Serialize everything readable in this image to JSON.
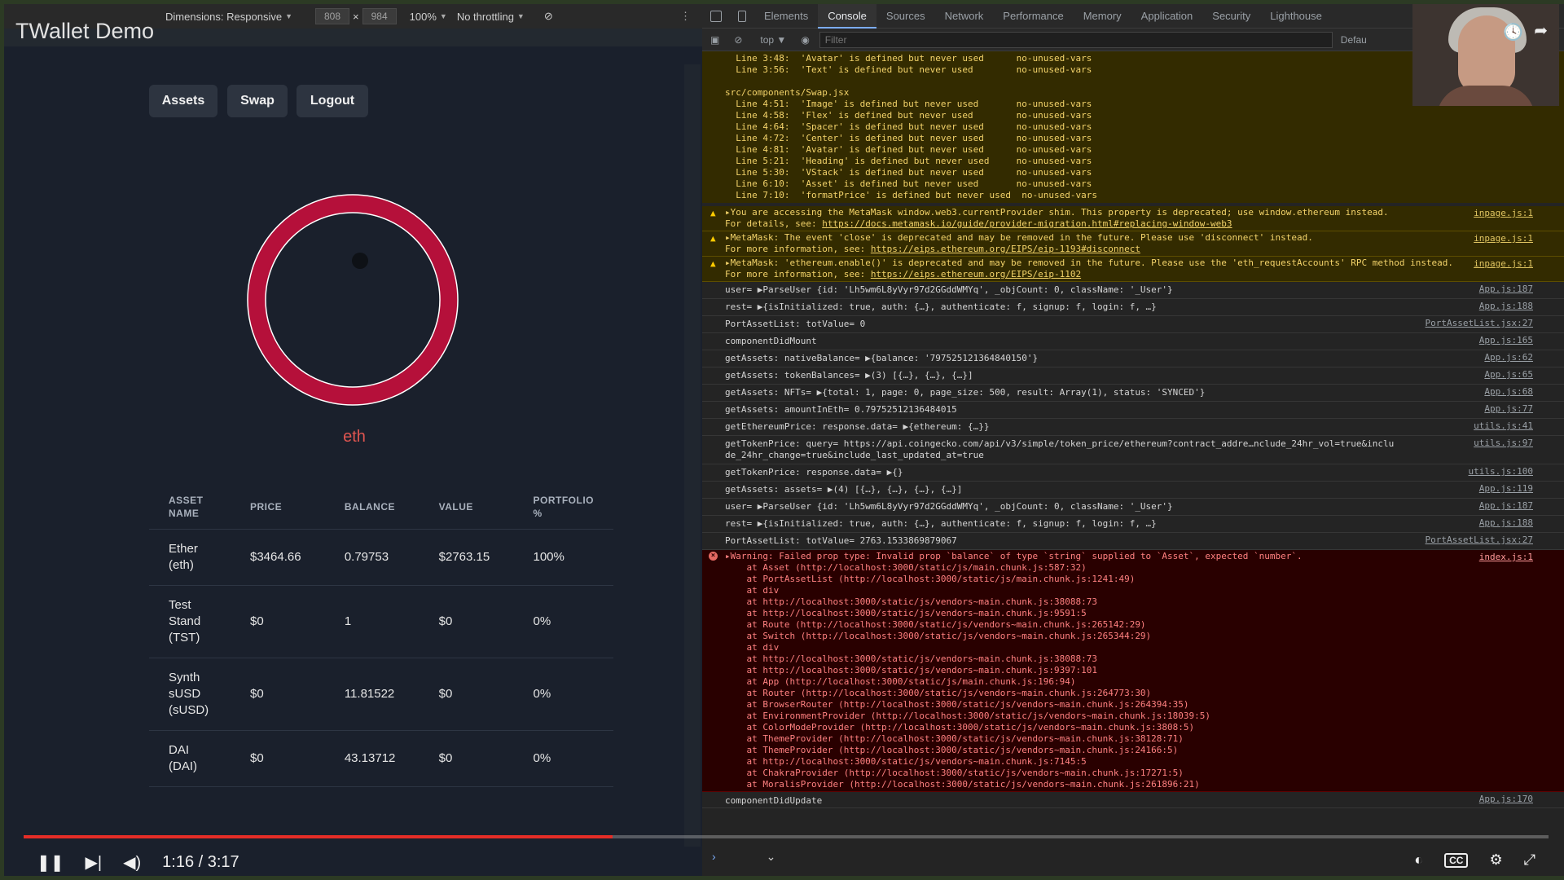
{
  "device_toolbar": {
    "dimensions_label": "Dimensions: Responsive",
    "width": "808",
    "height": "984",
    "zoom": "100%",
    "throttling": "No throttling"
  },
  "app": {
    "title": "TWallet Demo",
    "nav": [
      "Assets",
      "Swap",
      "Logout"
    ],
    "token_label": "eth",
    "donut_color": "#b5103a",
    "table": {
      "headers": [
        "ASSET NAME",
        "PRICE",
        "BALANCE",
        "VALUE",
        "PORTFOLIO %"
      ],
      "rows": [
        [
          "Ether (eth)",
          "$3464.66",
          "0.79753",
          "$2763.15",
          "100%"
        ],
        [
          "Test Stand (TST)",
          "$0",
          "1",
          "$0",
          "0%"
        ],
        [
          "Synth sUSD (sUSD)",
          "$0",
          "11.81522",
          "$0",
          "0%"
        ],
        [
          "DAI (DAI)",
          "$0",
          "43.13712",
          "$0",
          "0%"
        ]
      ]
    }
  },
  "video": {
    "time": "1:16 / 3:17",
    "progress": 0.386
  },
  "devtools": {
    "tabs": [
      "Elements",
      "Console",
      "Sources",
      "Network",
      "Performance",
      "Memory",
      "Application",
      "Security",
      "Lighthouse"
    ],
    "active_tab": "Console",
    "context": "top",
    "filter_placeholder": "Filter",
    "levels": "Defau",
    "lint_lines": [
      "  Line 3:48:  'Avatar' is defined but never used      no-unused-vars",
      "  Line 3:56:  'Text' is defined but never used        no-unused-vars",
      "",
      "src/components/Swap.jsx",
      "  Line 4:51:  'Image' is defined but never used       no-unused-vars",
      "  Line 4:58:  'Flex' is defined but never used        no-unused-vars",
      "  Line 4:64:  'Spacer' is defined but never used      no-unused-vars",
      "  Line 4:72:  'Center' is defined but never used      no-unused-vars",
      "  Line 4:81:  'Avatar' is defined but never used      no-unused-vars",
      "  Line 5:21:  'Heading' is defined but never used     no-unused-vars",
      "  Line 5:30:  'VStack' is defined but never used      no-unused-vars",
      "  Line 6:10:  'Asset' is defined but never used       no-unused-vars",
      "  Line 7:10:  'formatPrice' is defined but never used  no-unused-vars"
    ],
    "warnings": [
      {
        "text": "You are accessing the MetaMask window.web3.currentProvider shim. This property is deprecated; use window.ethereum instead.",
        "more": "For details, see: ",
        "link": "https://docs.metamask.io/guide/provider-migration.html#replacing-window-web3",
        "src": "inpage.js:1"
      },
      {
        "text": "MetaMask: The event 'close' is deprecated and may be removed in the future. Please use 'disconnect' instead.",
        "more": "For more information, see: ",
        "link": "https://eips.ethereum.org/EIPS/eip-1193#disconnect",
        "src": "inpage.js:1"
      },
      {
        "text": "MetaMask: 'ethereum.enable()' is deprecated and may be removed in the future. Please use the 'eth_requestAccounts' RPC method instead.",
        "more": "For more information, see: ",
        "link": "https://eips.ethereum.org/EIPS/eip-1102",
        "src": "inpage.js:1"
      }
    ],
    "logs": [
      {
        "text": "user= ▶ParseUser {id: 'Lh5wm6L8yVyr97d2GGddWMYq', _objCount: 0, className: '_User'}",
        "src": "App.js:187"
      },
      {
        "text": "rest= ▶{isInitialized: true, auth: {…}, authenticate: f, signup: f, login: f, …}",
        "src": "App.js:188"
      },
      {
        "text": "PortAssetList: totValue= 0",
        "src": "PortAssetList.jsx:27"
      },
      {
        "text": "componentDidMount",
        "src": "App.js:165"
      },
      {
        "text": "getAssets: nativeBalance= ▶{balance: '797525121364840150'}",
        "src": "App.js:62"
      },
      {
        "text": "getAssets: tokenBalances= ▶(3) [{…}, {…}, {…}]",
        "src": "App.js:65"
      },
      {
        "text": "getAssets: NFTs= ▶{total: 1, page: 0, page_size: 500, result: Array(1), status: 'SYNCED'}",
        "src": "App.js:68"
      },
      {
        "text": "getAssets: amountInEth= 0.79752512136484015",
        "src": "App.js:77"
      },
      {
        "text": "getEthereumPrice: response.data= ▶{ethereum: {…}}",
        "src": "utils.js:41"
      },
      {
        "text": "getTokenPrice: query= https://api.coingecko.com/api/v3/simple/token_price/ethereum?contract_addre…nclude_24hr_vol=true&inclu de_24hr_change=true&include_last_updated_at=true",
        "src": "utils.js:97"
      },
      {
        "text": "getTokenPrice: response.data= ▶{}",
        "src": "utils.js:100"
      },
      {
        "text": "getAssets: assets= ▶(4) [{…}, {…}, {…}, {…}]",
        "src": "App.js:119"
      },
      {
        "text": "user= ▶ParseUser {id: 'Lh5wm6L8yVyr97d2GGddWMYq', _objCount: 0, className: '_User'}",
        "src": "App.js:187"
      },
      {
        "text": "rest= ▶{isInitialized: true, auth: {…}, authenticate: f, signup: f, login: f, …}",
        "src": "App.js:188"
      },
      {
        "text": "PortAssetList: totValue= 2763.1533869879067",
        "src": "PortAssetList.jsx:27"
      }
    ],
    "error": {
      "text": "Warning: Failed prop type: Invalid prop `balance` of type `string` supplied to `Asset`, expected `number`.",
      "src": "index.js:1",
      "stack": [
        "at Asset (http://localhost:3000/static/js/main.chunk.js:587:32)",
        "at PortAssetList (http://localhost:3000/static/js/main.chunk.js:1241:49)",
        "at div",
        "at http://localhost:3000/static/js/vendors~main.chunk.js:38088:73",
        "at http://localhost:3000/static/js/vendors~main.chunk.js:9591:5",
        "at Route (http://localhost:3000/static/js/vendors~main.chunk.js:265142:29)",
        "at Switch (http://localhost:3000/static/js/vendors~main.chunk.js:265344:29)",
        "at div",
        "at http://localhost:3000/static/js/vendors~main.chunk.js:38088:73",
        "at http://localhost:3000/static/js/vendors~main.chunk.js:9397:101",
        "at App (http://localhost:3000/static/js/main.chunk.js:196:94)",
        "at Router (http://localhost:3000/static/js/vendors~main.chunk.js:264773:30)",
        "at BrowserRouter (http://localhost:3000/static/js/vendors~main.chunk.js:264394:35)",
        "at EnvironmentProvider (http://localhost:3000/static/js/vendors~main.chunk.js:18039:5)",
        "at ColorModeProvider (http://localhost:3000/static/js/vendors~main.chunk.js:3808:5)",
        "at ThemeProvider (http://localhost:3000/static/js/vendors~main.chunk.js:38128:71)",
        "at ThemeProvider (http://localhost:3000/static/js/vendors~main.chunk.js:24166:5)",
        "at http://localhost:3000/static/js/vendors~main.chunk.js:7145:5",
        "at ChakraProvider (http://localhost:3000/static/js/vendors~main.chunk.js:17271:5)",
        "at MoralisProvider (http://localhost:3000/static/js/vendors~main.chunk.js:261896:21)"
      ]
    },
    "last_log": {
      "text": "componentDidUpdate",
      "src": "App.js:170"
    }
  }
}
